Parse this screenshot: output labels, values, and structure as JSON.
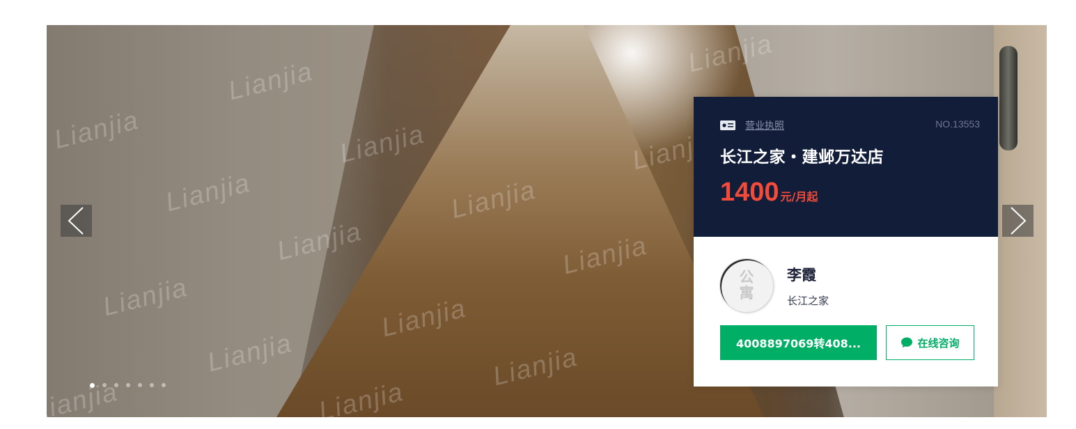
{
  "gallery": {
    "watermark_text": "Lianjia",
    "slide_count": 7,
    "active_slide": 1
  },
  "card": {
    "license_link": "营业执照",
    "license_no": "NO.13553",
    "store_name": "长江之家・建邺万达店",
    "price_value": "1400",
    "price_unit": "元/月起",
    "header_bg": "#121d3a",
    "price_color": "#f24b39"
  },
  "agent": {
    "avatar_text_1": "公",
    "avatar_text_2": "寓",
    "name": "李霞",
    "company": "长江之家"
  },
  "actions": {
    "phone_label": "4008897069转408...",
    "consult_label": "在线咨询",
    "accent_color": "#00ae66"
  },
  "icons": {
    "license": "license-card-icon",
    "chat": "chat-bubble-icon",
    "prev": "chevron-left-icon",
    "next": "chevron-right-icon"
  }
}
